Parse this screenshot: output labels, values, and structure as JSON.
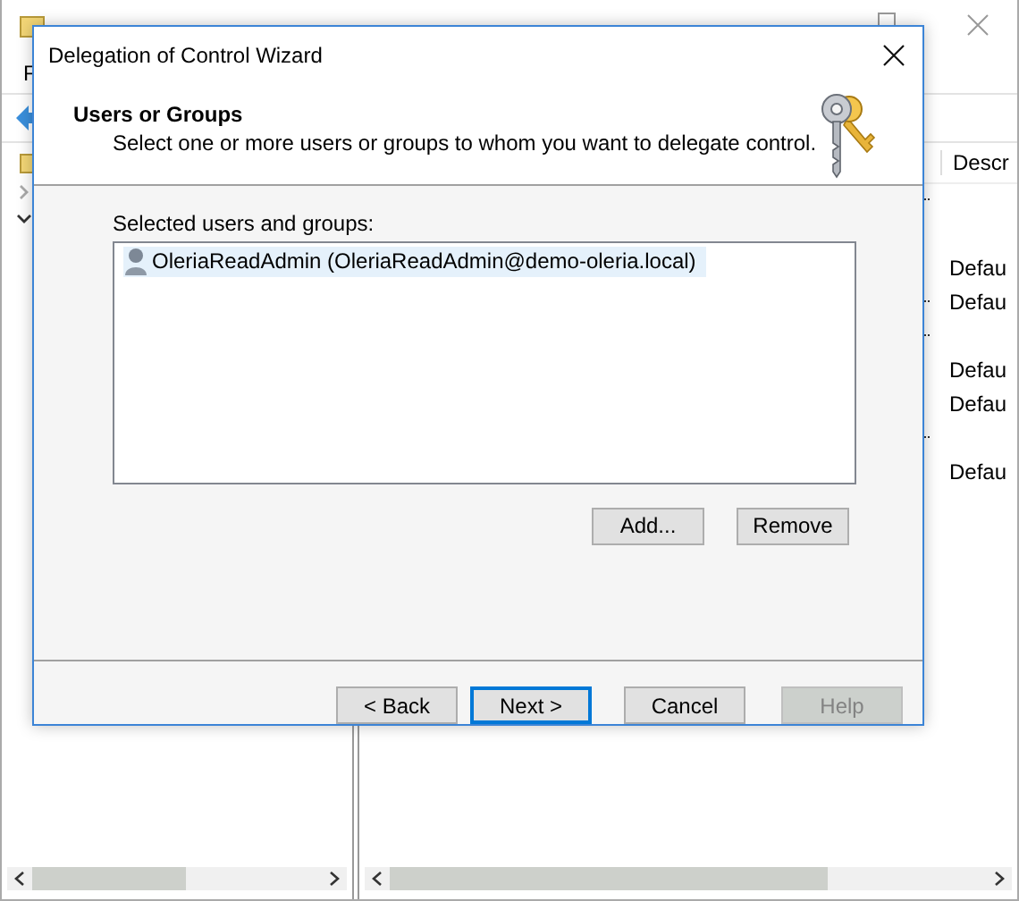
{
  "background_window": {
    "menu": [
      "F"
    ],
    "tree": [
      {
        "expanded": false
      },
      {
        "expanded": true
      }
    ],
    "column_header": "Descr",
    "rows": [
      {
        "more": true
      },
      {
        "more": false
      },
      {
        "more": false,
        "description": "Defau"
      },
      {
        "more": true,
        "description": "Defau"
      },
      {
        "more": true
      },
      {
        "more": false,
        "description": "Defau"
      },
      {
        "more": false,
        "description": "Defau"
      },
      {
        "more": true
      },
      {
        "more": false,
        "description": "Defau"
      }
    ]
  },
  "dialog": {
    "title": "Delegation of Control Wizard",
    "header": {
      "title": "Users or Groups",
      "subtitle": "Select one or more users or groups to whom you want to delegate control."
    },
    "list_label": "Selected users and groups:",
    "entries": [
      {
        "name": "OleriaReadAdmin (OleriaReadAdmin@demo-oleria.local)",
        "selected": true
      }
    ],
    "list_buttons": [
      {
        "label": "Add..."
      },
      {
        "label": "Remove"
      }
    ],
    "nav_buttons": [
      {
        "label": "< Back",
        "default": false,
        "disabled": false
      },
      {
        "label": "Next >",
        "default": true,
        "disabled": false
      },
      {
        "label": "Cancel",
        "default": false,
        "disabled": false
      },
      {
        "label": "Help",
        "default": false,
        "disabled": true
      }
    ]
  }
}
